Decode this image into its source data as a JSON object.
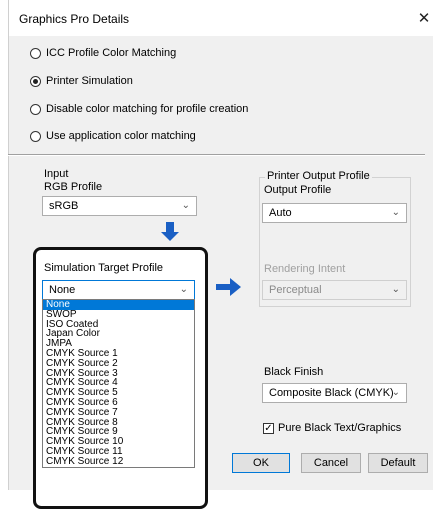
{
  "window": {
    "title": "Graphics Pro Details",
    "close_glyph": "✕"
  },
  "color_matching": {
    "options": [
      {
        "label": "ICC Profile Color Matching",
        "selected": false
      },
      {
        "label": "Printer Simulation",
        "selected": true
      },
      {
        "label": "Disable color matching for profile creation",
        "selected": false
      },
      {
        "label": "Use application color matching",
        "selected": false
      }
    ]
  },
  "input": {
    "group_label": "Input",
    "rgb_profile_label": "RGB Profile",
    "rgb_profile_value": "sRGB"
  },
  "simulation": {
    "label": "Simulation Target Profile",
    "selected_value": "None",
    "options": [
      "None",
      "SWOP",
      "ISO Coated",
      "Japan Color",
      "JMPA",
      "CMYK Source 1",
      "CMYK Source 2",
      "CMYK Source 3",
      "CMYK Source 4",
      "CMYK Source 5",
      "CMYK Source 6",
      "CMYK Source 7",
      "CMYK Source 8",
      "CMYK Source 9",
      "CMYK Source 10",
      "CMYK Source 11",
      "CMYK Source 12"
    ]
  },
  "printer_output": {
    "group_label": "Printer Output Profile",
    "output_profile_label": "Output Profile",
    "output_profile_value": "Auto",
    "rendering_intent_label": "Rendering Intent",
    "rendering_intent_value": "Perceptual"
  },
  "black": {
    "finish_label": "Black Finish",
    "finish_value": "Composite Black (CMYK)",
    "pure_black_label": "Pure Black Text/Graphics",
    "pure_black_checked": true
  },
  "buttons": {
    "ok": "OK",
    "cancel": "Cancel",
    "default": "Default"
  },
  "colors": {
    "annotation_arrow": "#1a5fc4",
    "list_highlight": "#0078d7"
  }
}
